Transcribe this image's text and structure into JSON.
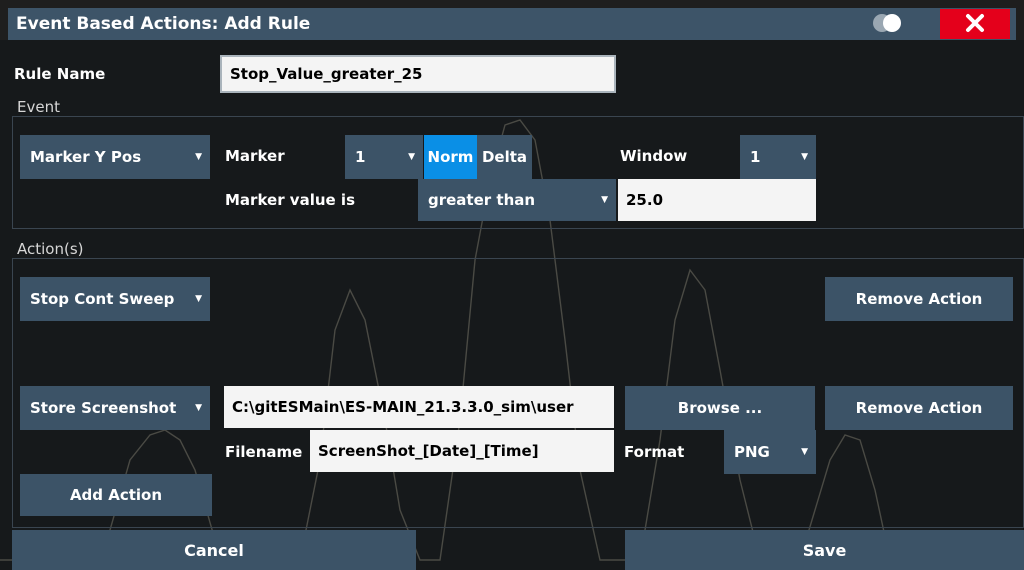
{
  "window": {
    "title": "Event Based Actions: Add Rule"
  },
  "rule": {
    "label": "Rule Name",
    "value": "Stop_Value_greater_25"
  },
  "event": {
    "section_label": "Event",
    "source_dropdown": "Marker Y Pos",
    "marker_label": "Marker",
    "marker_dropdown": "1",
    "mode_norm": "Norm",
    "mode_delta": "Delta",
    "mode_selected": "Norm",
    "window_label": "Window",
    "window_dropdown": "1",
    "condition_label": "Marker value is",
    "condition_dropdown": "greater than",
    "threshold_value": "25.0"
  },
  "actions": {
    "section_label": "Action(s)",
    "action1": {
      "type": "Stop Cont Sweep",
      "remove_label": "Remove Action"
    },
    "action2": {
      "type": "Store Screenshot",
      "path_value": "C:\\gitESMain\\ES-MAIN_21.3.3.0_sim\\user",
      "browse_label": "Browse ...",
      "remove_label": "Remove Action",
      "filename_label": "Filename",
      "filename_value": "ScreenShot_[Date]_[Time]",
      "format_label": "Format",
      "format_dropdown": "PNG"
    },
    "add_label": "Add Action"
  },
  "footer": {
    "cancel_label": "Cancel",
    "save_label": "Save"
  },
  "colors": {
    "titlebar": "#3d5468",
    "button": "#3c5367",
    "accent": "#0a8fe6",
    "close": "#e4001b",
    "background": "#16191b"
  }
}
